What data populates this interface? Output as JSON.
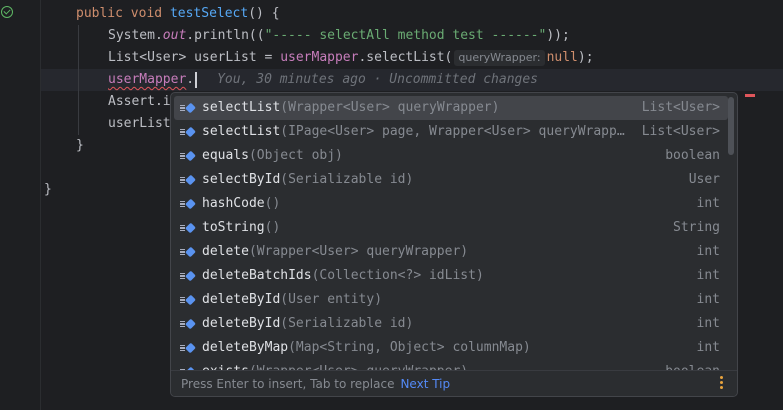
{
  "editor": {
    "line1": {
      "kw1": "public",
      "kw2": "void",
      "name": "testSelect",
      "rest": "() {"
    },
    "line2": {
      "pre": "System.",
      "field": "out",
      "mid": ".println((",
      "str": "\"----- selectAll method test ------\"",
      "end": "));"
    },
    "line3": {
      "pre": "List<User> userList = ",
      "field": "userMapper",
      "mid": ".selectList(",
      "hint": "queryWrapper:",
      "kw": "null",
      "end": ");"
    },
    "line4": {
      "field": "userMapper",
      "dot": ".",
      "blame": "You, 30 minutes ago · Uncommitted changes"
    },
    "line5": {
      "text": "Assert.i"
    },
    "line6": {
      "text": "userList"
    },
    "line7": {
      "text": "}"
    },
    "line8": {
      "text": "}"
    }
  },
  "completion": {
    "items": [
      {
        "name": "selectList",
        "params": "(Wrapper<User> queryWrapper)",
        "type": "List<User>"
      },
      {
        "name": "selectList",
        "params": "(IPage<User> page, Wrapper<User> queryWrapp…",
        "type": "List<User>"
      },
      {
        "name": "equals",
        "params": "(Object obj)",
        "type": "boolean"
      },
      {
        "name": "selectById",
        "params": "(Serializable id)",
        "type": "User"
      },
      {
        "name": "hashCode",
        "params": "()",
        "type": "int"
      },
      {
        "name": "toString",
        "params": "()",
        "type": "String"
      },
      {
        "name": "delete",
        "params": "(Wrapper<User> queryWrapper)",
        "type": "int"
      },
      {
        "name": "deleteBatchIds",
        "params": "(Collection<?> idList)",
        "type": "int"
      },
      {
        "name": "deleteById",
        "params": "(User entity)",
        "type": "int"
      },
      {
        "name": "deleteById",
        "params": "(Serializable id)",
        "type": "int"
      },
      {
        "name": "deleteByMap",
        "params": "(Map<String, Object> columnMap)",
        "type": "int"
      },
      {
        "name": "exists",
        "params": "(Wrapper<User> queryWrapper)",
        "type": "boolean"
      }
    ],
    "footer": {
      "hint": "Press Enter to insert, Tab to replace",
      "next_tip": "Next Tip"
    }
  }
}
